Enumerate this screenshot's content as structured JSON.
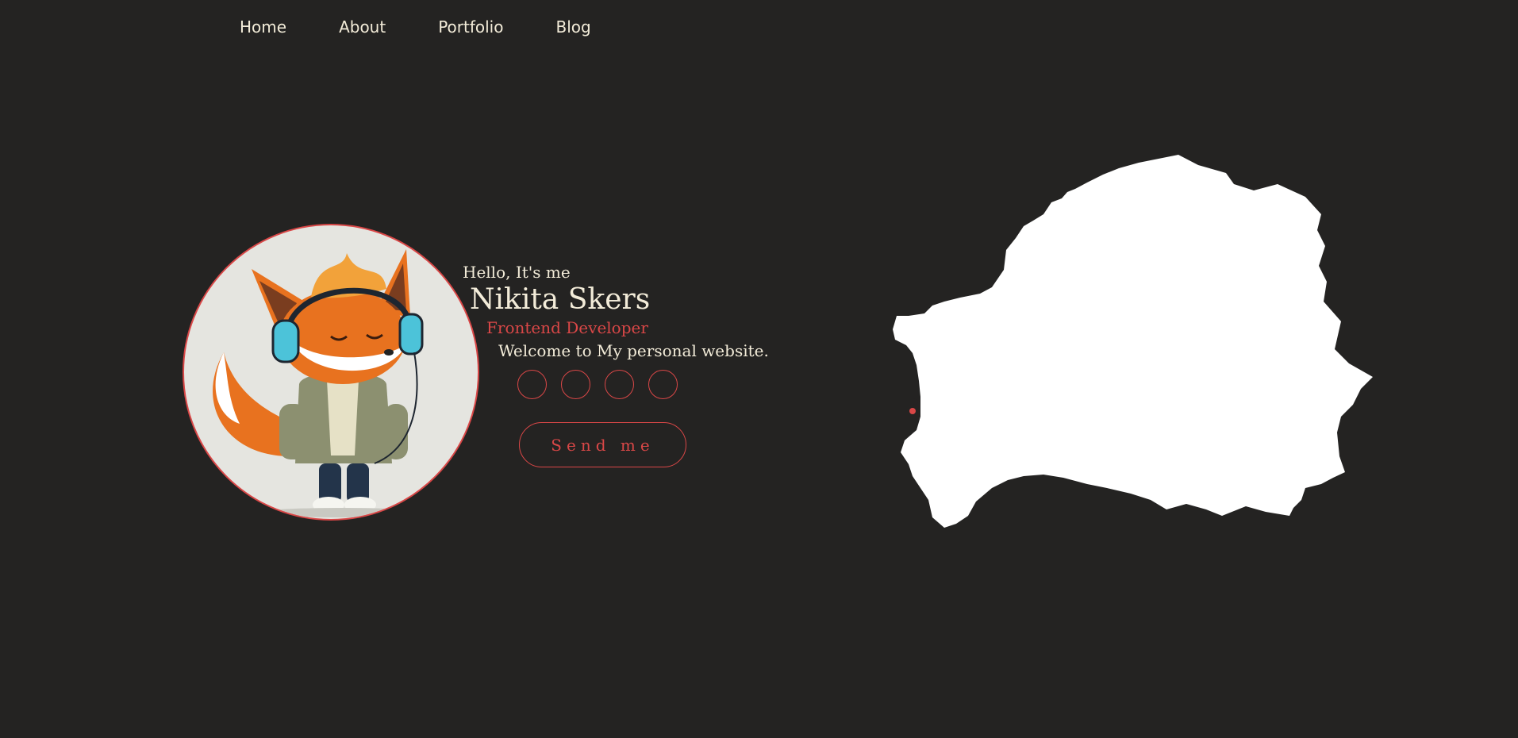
{
  "nav": {
    "items": [
      {
        "label": "Home"
      },
      {
        "label": "About"
      },
      {
        "label": "Portfolio"
      },
      {
        "label": "Blog"
      }
    ]
  },
  "hero": {
    "greeting": "Hello, It's me",
    "name": "Nikita Skers",
    "role": "Frontend Developer",
    "welcome": "Welcome to My personal website.",
    "send_label": "Send me"
  },
  "colors": {
    "background": "#242322",
    "accent": "#d94747",
    "text": "#f3ecd9",
    "map_fill": "#ffffff"
  },
  "icons": {
    "social": [
      "social-icon-1",
      "social-icon-2",
      "social-icon-3",
      "social-icon-4"
    ],
    "map_marker": "flag-icon"
  }
}
